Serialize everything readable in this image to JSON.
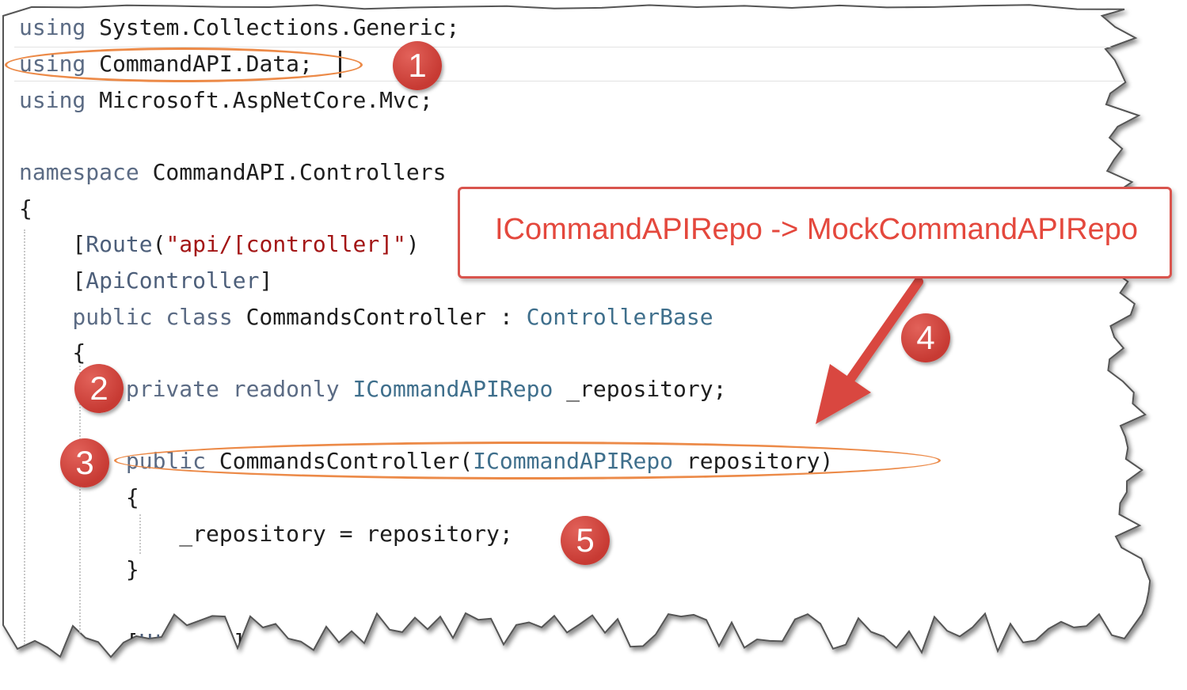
{
  "code": {
    "lines": [
      [
        {
          "t": "using",
          "c": "kw"
        },
        {
          "t": " System.Collections.Generic;",
          "c": "plain"
        }
      ],
      [
        {
          "t": "using",
          "c": "kw"
        },
        {
          "t": " CommandAPI.Data;",
          "c": "plain"
        }
      ],
      [
        {
          "t": "using",
          "c": "kw"
        },
        {
          "t": " Microsoft.AspNetCore.Mvc;",
          "c": "plain"
        }
      ],
      [],
      [
        {
          "t": "namespace",
          "c": "kw"
        },
        {
          "t": " CommandAPI.Controllers",
          "c": "plain"
        }
      ],
      [
        {
          "t": "{",
          "c": "plain"
        }
      ],
      [
        {
          "t": "    [",
          "c": "plain"
        },
        {
          "t": "Route",
          "c": "attr"
        },
        {
          "t": "(",
          "c": "plain"
        },
        {
          "t": "\"api/[controller]\"",
          "c": "str"
        },
        {
          "t": ")",
          "c": "plain"
        }
      ],
      [
        {
          "t": "    [",
          "c": "plain"
        },
        {
          "t": "ApiController",
          "c": "attr"
        },
        {
          "t": "]",
          "c": "plain"
        }
      ],
      [
        {
          "t": "    public class",
          "c": "kw"
        },
        {
          "t": " CommandsController ",
          "c": "plain"
        },
        {
          "t": ":",
          "c": "plain"
        },
        {
          "t": " ControllerBase",
          "c": "type"
        }
      ],
      [
        {
          "t": "    {",
          "c": "plain"
        }
      ],
      [
        {
          "t": "        private readonly",
          "c": "kw"
        },
        {
          "t": " ",
          "c": "plain"
        },
        {
          "t": "ICommandAPIRepo",
          "c": "type"
        },
        {
          "t": " _repository;",
          "c": "plain"
        }
      ],
      [],
      [
        {
          "t": "        public",
          "c": "kw"
        },
        {
          "t": " CommandsController(",
          "c": "plain"
        },
        {
          "t": "ICommandAPIRepo",
          "c": "type"
        },
        {
          "t": " repository)",
          "c": "plain"
        }
      ],
      [
        {
          "t": "        {",
          "c": "plain"
        }
      ],
      [
        {
          "t": "            _repository = repository;",
          "c": "plain"
        }
      ],
      [
        {
          "t": "        }",
          "c": "plain"
        }
      ],
      [],
      [
        {
          "t": "        [",
          "c": "plain"
        },
        {
          "t": "HttpGet",
          "c": "attr"
        },
        {
          "t": "]",
          "c": "plain"
        }
      ]
    ]
  },
  "callout": {
    "text": "ICommandAPIRepo -> MockCommandAPIRepo"
  },
  "badges": [
    "1",
    "2",
    "3",
    "4",
    "5"
  ],
  "colors": {
    "keyword": "#5b6b84",
    "type": "#3f6f8c",
    "string": "#a31515",
    "highlight_oval": "#ec8a48",
    "badge": "#c73a33",
    "callout_text": "#e4483d",
    "arrow": "#d9473f"
  }
}
